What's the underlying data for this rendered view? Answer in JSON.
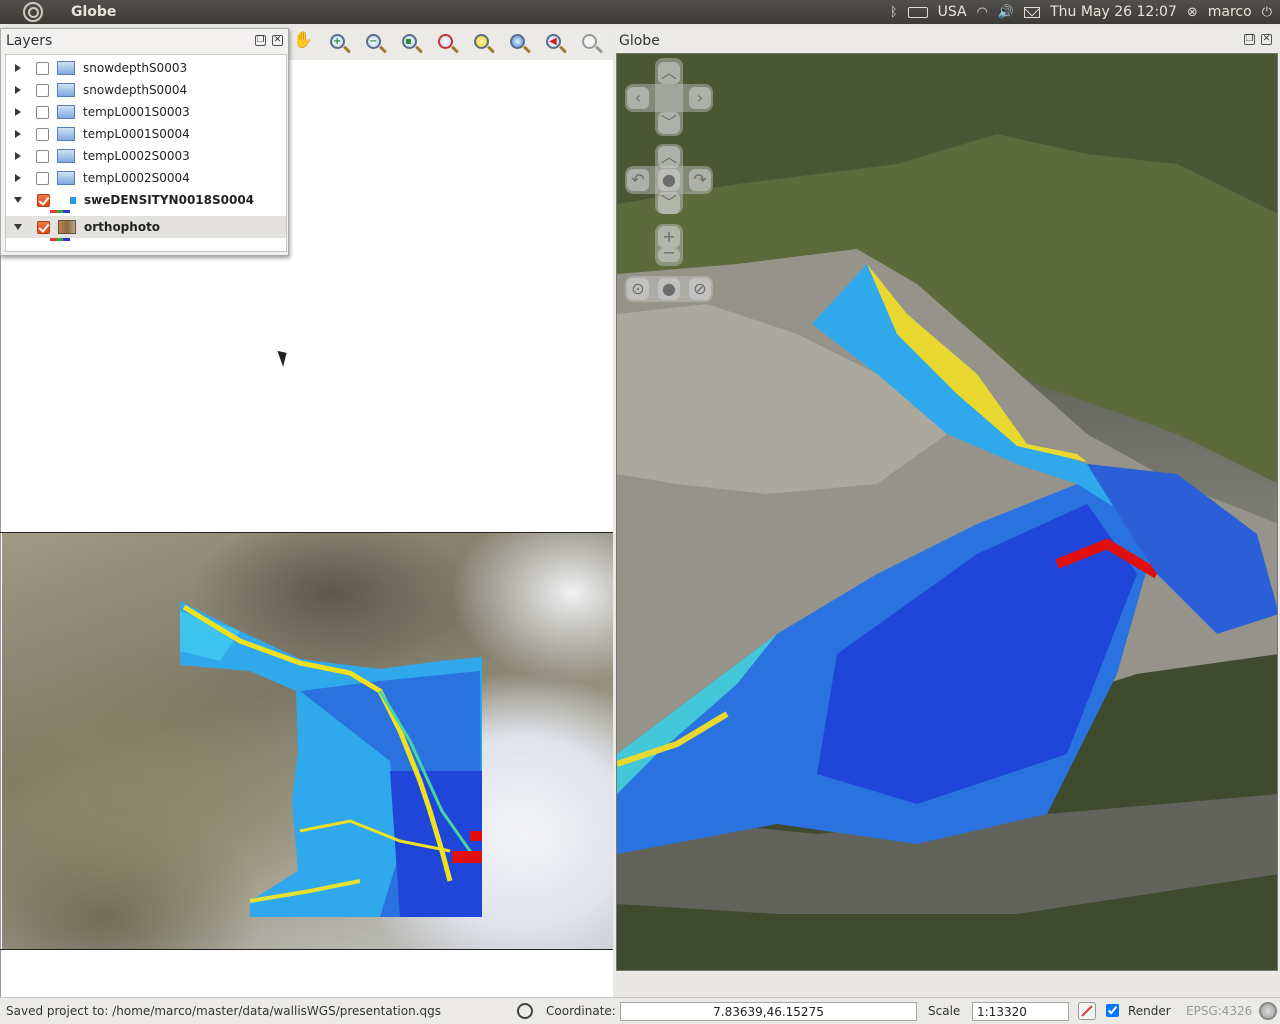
{
  "system_bar": {
    "app_title": "Globe",
    "keyboard_layout": "USA",
    "datetime": "Thu May 26 12:07",
    "user": "marco"
  },
  "layers_panel": {
    "title": "Layers",
    "layers": [
      {
        "name": "snowdepthS0003",
        "checked": false,
        "expanded": false
      },
      {
        "name": "snowdepthS0004",
        "checked": false,
        "expanded": false
      },
      {
        "name": "tempL0001S0003",
        "checked": false,
        "expanded": false
      },
      {
        "name": "tempL0001S0004",
        "checked": false,
        "expanded": false
      },
      {
        "name": "tempL0002S0003",
        "checked": false,
        "expanded": false
      },
      {
        "name": "tempL0002S0004",
        "checked": false,
        "expanded": false
      },
      {
        "name": "sweDENSITYN0018S0004",
        "checked": true,
        "expanded": true
      },
      {
        "name": "orthophoto",
        "checked": true,
        "expanded": true
      }
    ]
  },
  "globe_panel": {
    "title": "Globe"
  },
  "status_bar": {
    "message": "Saved project to: /home/marco/master/data/wallisWGS/presentation.qgs",
    "coordinate_label": "Coordinate:",
    "coordinate_value": "7.83639,46.15275",
    "scale_label": "Scale",
    "scale_value": "1:13320",
    "render_label": "Render",
    "render_checked": true,
    "crs": "EPSG:4326"
  },
  "colors": {
    "accent": "#dd4814",
    "panel_dark": "#3c3b37",
    "swe_low": "#1f3fd6",
    "swe_mid": "#2fb3e8",
    "swe_high": "#f0e020",
    "swe_peak": "#e01010"
  }
}
